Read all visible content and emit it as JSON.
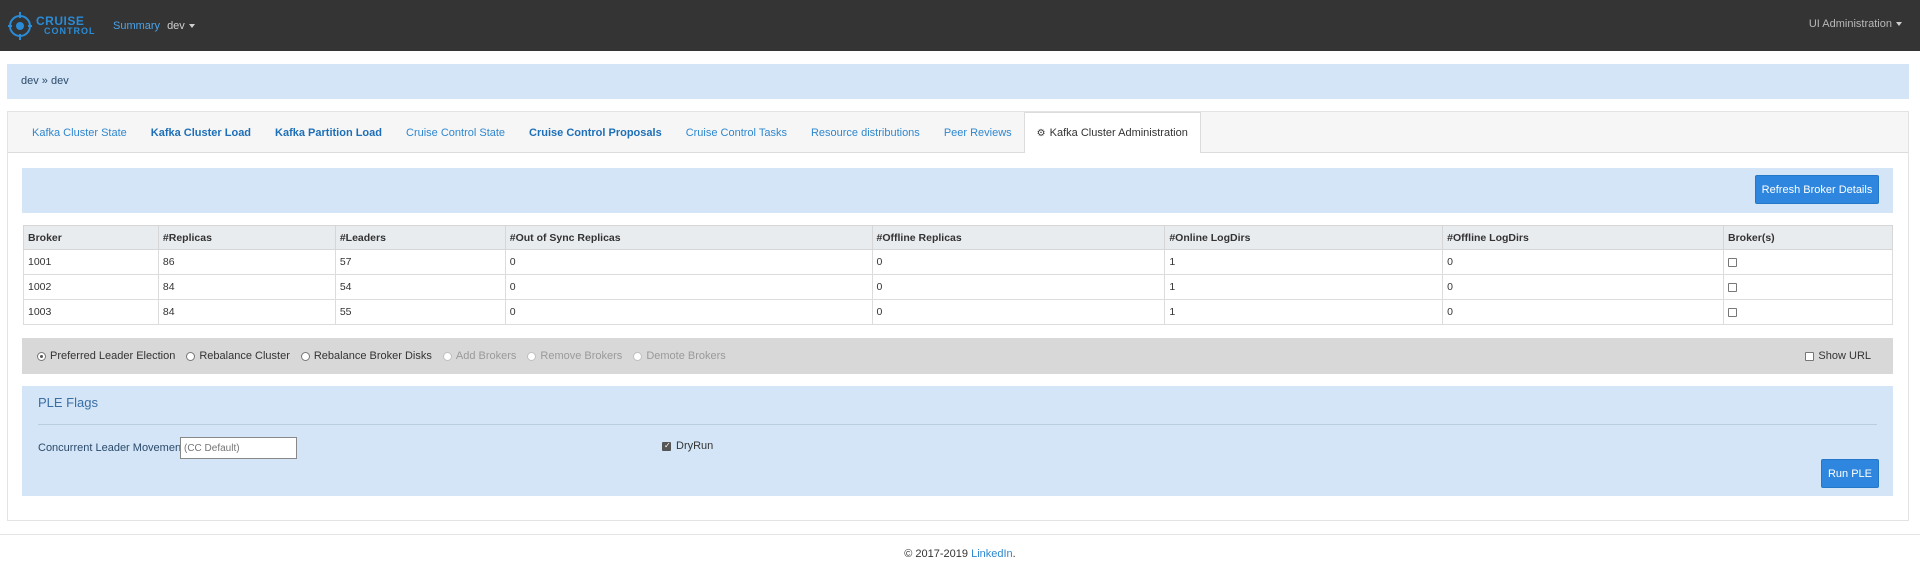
{
  "navbar": {
    "logo_line1": "CRUISE",
    "logo_line2": "CONTROL",
    "summary": "Summary",
    "env": "dev",
    "admin": "UI Administration"
  },
  "breadcrumb": "dev » dev",
  "tabs": [
    {
      "label": "Kafka Cluster State"
    },
    {
      "label": "Kafka Cluster Load"
    },
    {
      "label": "Kafka Partition Load"
    },
    {
      "label": "Cruise Control State"
    },
    {
      "label": "Cruise Control Proposals"
    },
    {
      "label": "Cruise Control Tasks"
    },
    {
      "label": "Resource distributions"
    },
    {
      "label": "Peer Reviews"
    },
    {
      "label": "Kafka Cluster Administration"
    }
  ],
  "refresh_button": "Refresh Broker Details",
  "table": {
    "headers": [
      "Broker",
      "#Replicas",
      "#Leaders",
      "#Out of Sync Replicas",
      "#Offline Replicas",
      "#Online LogDirs",
      "#Offline LogDirs",
      "Broker(s)"
    ],
    "rows": [
      [
        "1001",
        "86",
        "57",
        "0",
        "0",
        "1",
        "0"
      ],
      [
        "1002",
        "84",
        "54",
        "0",
        "0",
        "1",
        "0"
      ],
      [
        "1003",
        "84",
        "55",
        "0",
        "0",
        "1",
        "0"
      ]
    ]
  },
  "actions": {
    "options": [
      {
        "label": "Preferred Leader Election",
        "selected": true,
        "disabled": false
      },
      {
        "label": "Rebalance Cluster",
        "selected": false,
        "disabled": false
      },
      {
        "label": "Rebalance Broker Disks",
        "selected": false,
        "disabled": false
      },
      {
        "label": "Add Brokers",
        "selected": false,
        "disabled": true
      },
      {
        "label": "Remove Brokers",
        "selected": false,
        "disabled": true
      },
      {
        "label": "Demote Brokers",
        "selected": false,
        "disabled": true
      }
    ],
    "show_url": "Show URL"
  },
  "ple": {
    "title": "PLE Flags",
    "concurrent_label": "Concurrent Leader Movements",
    "concurrent_placeholder": "(CC Default)",
    "dryrun_label": "DryRun",
    "run_button": "Run PLE"
  },
  "footer": {
    "copyright": "© 2017-2019 ",
    "link": "LinkedIn",
    "period": "."
  }
}
